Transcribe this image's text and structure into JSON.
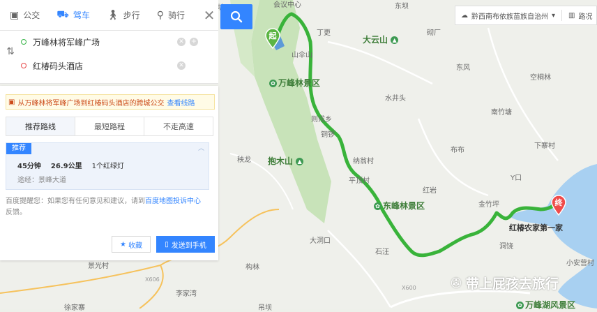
{
  "modes": [
    {
      "label": "公交",
      "icon": "bus-icon"
    },
    {
      "label": "驾车",
      "icon": "car-icon",
      "active": true
    },
    {
      "label": "步行",
      "icon": "walk-icon"
    },
    {
      "label": "骑行",
      "icon": "bike-icon"
    }
  ],
  "close_glyph": "✕",
  "start": "万峰林将军峰广场",
  "end": "红椿码头酒店",
  "notice": {
    "text": "从万峰林将军峰广场到红椿码头酒店的跨城公交",
    "link": "查看线路"
  },
  "tabs": [
    "推荐路线",
    "最短路程",
    "不走高速"
  ],
  "route": {
    "badge": "推荐",
    "time": "45分钟",
    "distance": "26.9公里",
    "lights": "1个红绿灯",
    "via": "途经：景峰大道"
  },
  "tip": {
    "text": "百度提醒您：如果您有任何意见和建议，请到",
    "link": "百度地图投诉中心",
    "tail": "反馈。"
  },
  "buttons": {
    "fav": "收藏",
    "send": "发送到手机"
  },
  "city": {
    "name": "黔西南布依族苗族自治州",
    "extra": "路况"
  },
  "markers": {
    "start": "起",
    "end": "终"
  },
  "map_labels": {
    "l1": "神仙坡",
    "l2": "会议中心",
    "l3": "东坝",
    "l4": "丁更",
    "l5": "大云山",
    "l6": "砌厂",
    "l7": "山伞山",
    "l8": "万峰林景区",
    "l9": "水井头",
    "l10": "东风",
    "l11": "空桐林",
    "l12": "则戎乡",
    "l13": "南竹塘",
    "l14": "铜锣",
    "l15": "下寨村",
    "l16": "秧龙",
    "l17": "抱木山",
    "l18": "纳翁村",
    "l19": "布布",
    "l20": "平顶村",
    "l21": "红岩",
    "l22": "Y口",
    "l23": "东峰林景区",
    "l24": "金竹坪",
    "l25": "红椿农家第一家",
    "l26": "洞饶",
    "l27": "大洞口",
    "l28": "石汪",
    "l29": "构林",
    "l30": "X600",
    "l31": "X606",
    "l32": "李家湾",
    "l33": "徐家寨",
    "l34": "万峰湖风景区",
    "l35": "小安营村",
    "l36": "吊坝",
    "l37": "景光村"
  },
  "watermark": "带上屁孩去旅行",
  "colors": {
    "route": "#39b33a",
    "accent": "#3385ff",
    "water": "#a4cdf0",
    "forest": "#c5e2b6"
  }
}
